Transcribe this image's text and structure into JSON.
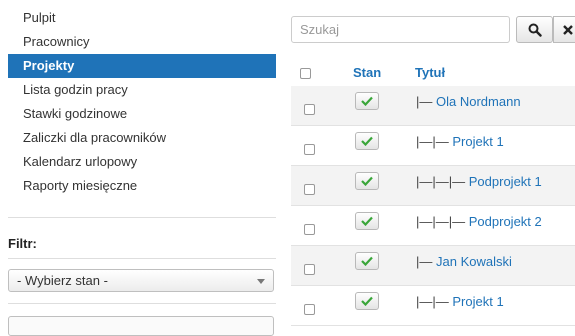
{
  "sidebar": {
    "items": [
      {
        "label": "Pulpit",
        "active": false
      },
      {
        "label": "Pracownicy",
        "active": false
      },
      {
        "label": "Projekty",
        "active": true
      },
      {
        "label": "Lista godzin pracy",
        "active": false
      },
      {
        "label": "Stawki godzinowe",
        "active": false
      },
      {
        "label": "Zaliczki dla pracowników",
        "active": false
      },
      {
        "label": "Kalendarz urlopowy",
        "active": false
      },
      {
        "label": "Raporty miesięczne",
        "active": false
      }
    ],
    "filter_label": "Filtr:",
    "state_select": "- Wybierz stan -"
  },
  "search": {
    "placeholder": "Szukaj"
  },
  "table": {
    "headers": {
      "stan": "Stan",
      "tytul": "Tytuł"
    },
    "rows": [
      {
        "prefix": "|—",
        "title": "Ola Nordmann",
        "published": true
      },
      {
        "prefix": "|—|—",
        "title": "Projekt 1",
        "published": true
      },
      {
        "prefix": "|—|—|—",
        "title": "Podprojekt 1",
        "published": true
      },
      {
        "prefix": "|—|—|—",
        "title": "Podprojekt 2",
        "published": true
      },
      {
        "prefix": "|—",
        "title": "Jan Kowalski",
        "published": true
      },
      {
        "prefix": "|—|—",
        "title": "Projekt 1",
        "published": true
      }
    ]
  },
  "colors": {
    "accent": "#1f73b8",
    "check": "#3aa63a"
  }
}
